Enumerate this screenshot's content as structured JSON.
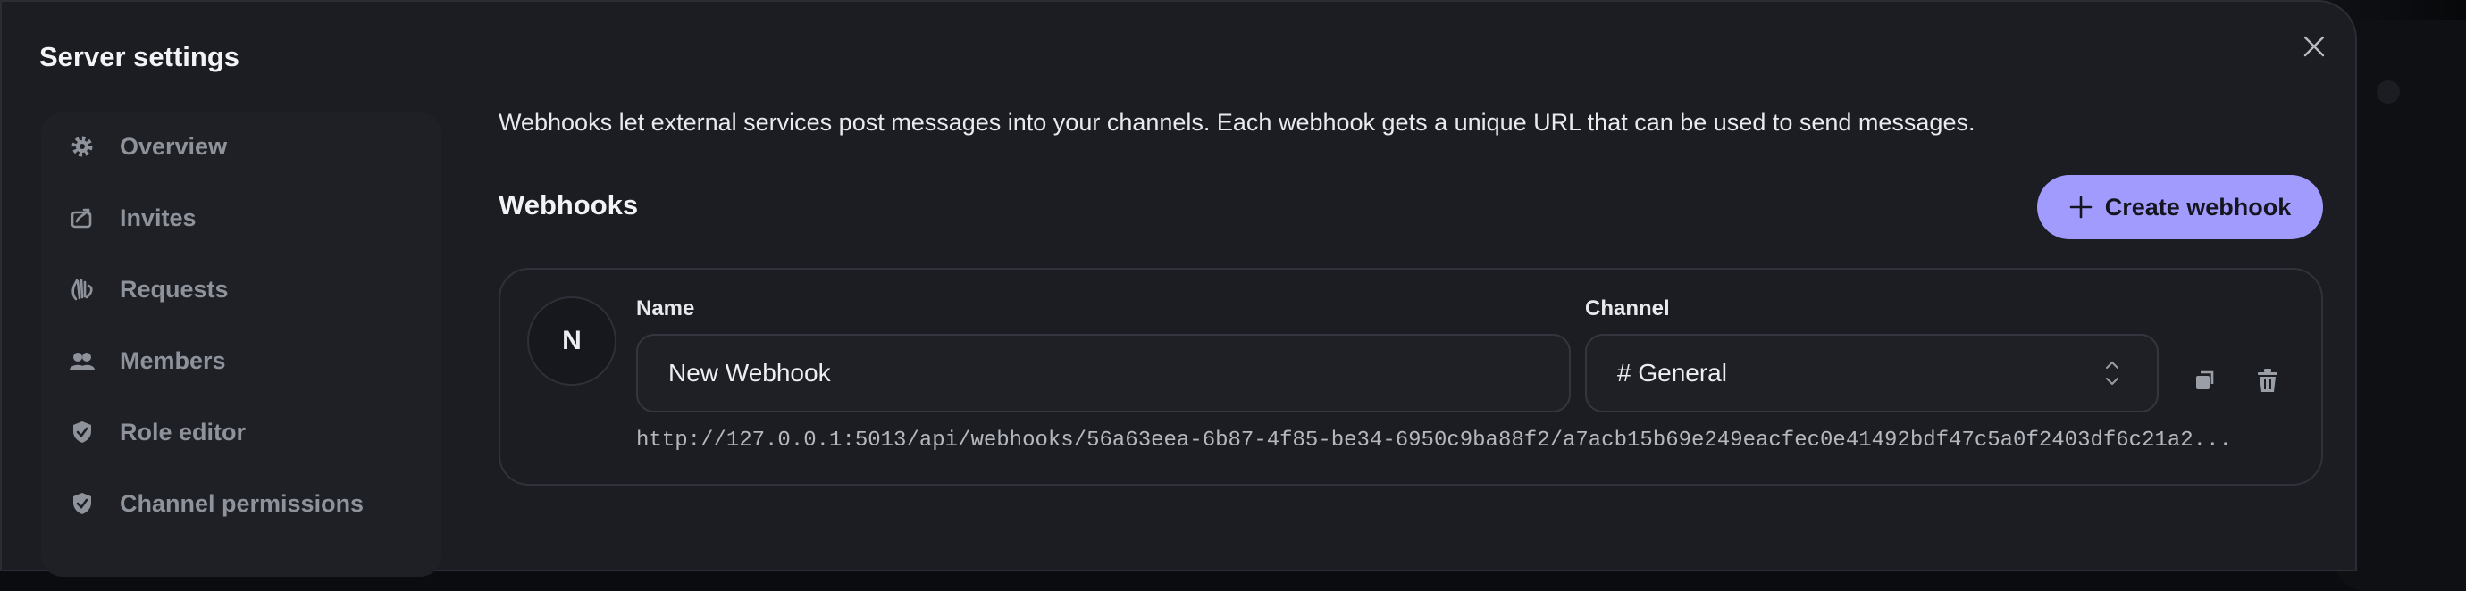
{
  "modal": {
    "title": "Server settings"
  },
  "sidebar": {
    "items": [
      {
        "label": "Overview",
        "icon": "gear-icon"
      },
      {
        "label": "Invites",
        "icon": "invite-icon"
      },
      {
        "label": "Requests",
        "icon": "wave-icon"
      },
      {
        "label": "Members",
        "icon": "members-icon"
      },
      {
        "label": "Role editor",
        "icon": "shield-icon"
      },
      {
        "label": "Channel permissions",
        "icon": "shield-icon"
      }
    ]
  },
  "main": {
    "intro": "Webhooks let external services post messages into your channels. Each webhook gets a unique URL that can be used to send messages.",
    "section_title": "Webhooks",
    "create_button_label": "Create webhook"
  },
  "webhook": {
    "avatar_letter": "N",
    "name_label": "Name",
    "name_value": "New Webhook",
    "channel_label": "Channel",
    "channel_value": "# General",
    "url": "http://127.0.0.1:5013/api/webhooks/56a63eea-6b87-4f85-be34-6950c9ba88f2/a7acb15b69e249eacfec0e41492bdf47c5a0f2403df6c21a2..."
  },
  "colors": {
    "accent": "#a29bfe",
    "modal_bg": "#1b1d23",
    "sidebar_bg": "#1e2026",
    "muted_text": "#8e929b"
  }
}
